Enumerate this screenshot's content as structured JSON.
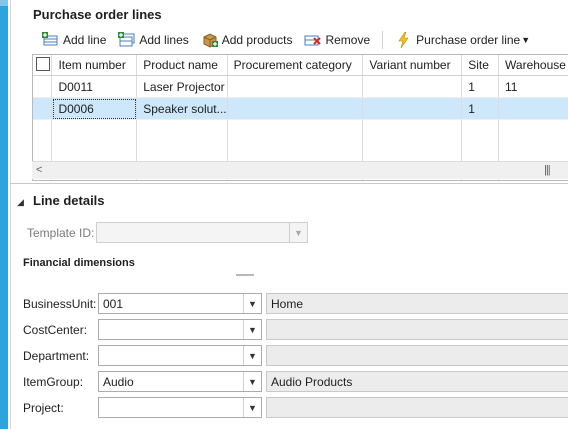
{
  "purchase_order_lines": {
    "title": "Purchase order lines",
    "toolbar": {
      "add_line": "Add line",
      "add_lines": "Add lines",
      "add_products": "Add products",
      "remove": "Remove",
      "purchase_order_line": "Purchase order line"
    },
    "columns": [
      "Item number",
      "Product name",
      "Procurement category",
      "Variant number",
      "Site",
      "Warehouse"
    ],
    "rows": [
      {
        "item": "D0011",
        "product": "Laser Projector",
        "category": "",
        "variant": "",
        "site": "1",
        "warehouse": "11"
      },
      {
        "item": "D0006",
        "product": "Speaker solut...",
        "category": "",
        "variant": "",
        "site": "1",
        "warehouse": ""
      }
    ]
  },
  "line_details": {
    "title": "Line details",
    "template_label": "Template ID:",
    "template_value": "",
    "financial_title": "Financial dimensions",
    "dimensions": [
      {
        "label": "BusinessUnit:",
        "value": "001",
        "description": "Home"
      },
      {
        "label": "CostCenter:",
        "value": "",
        "description": ""
      },
      {
        "label": "Department:",
        "value": "",
        "description": ""
      },
      {
        "label": "ItemGroup:",
        "value": "Audio",
        "description": "Audio Products"
      },
      {
        "label": "Project:",
        "value": "",
        "description": ""
      }
    ]
  },
  "colors": {
    "accent": "#2fa3de",
    "selection": "#cde8fb"
  }
}
